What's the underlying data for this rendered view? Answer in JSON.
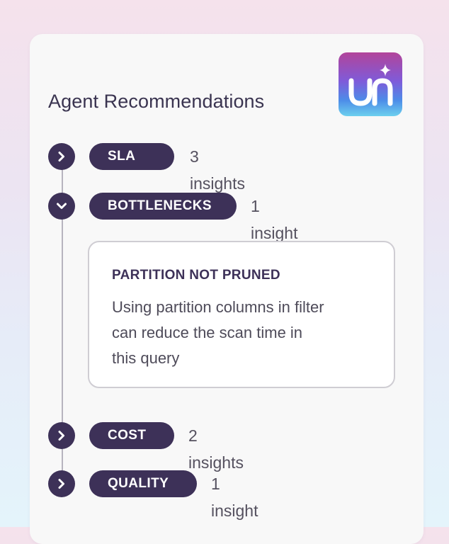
{
  "header": {
    "title": "Agent Recommendations"
  },
  "logo": {
    "icon": "un-sparkle-logo-icon"
  },
  "colors": {
    "accent": "#3d3158",
    "card_bg": "#f8f8f8",
    "border": "#cfcdd3"
  },
  "categories": [
    {
      "label": "SLA",
      "count": "3 insights",
      "expanded": false,
      "icon": "chevron-right-icon"
    },
    {
      "label": "BOTTLENECKS",
      "count": "1 insight",
      "expanded": true,
      "icon": "chevron-down-icon"
    },
    {
      "label": "COST",
      "count": "2 insights",
      "expanded": false,
      "icon": "chevron-right-icon"
    },
    {
      "label": "QUALITY",
      "count": "1 insight",
      "expanded": false,
      "icon": "chevron-right-icon"
    }
  ],
  "insight": {
    "title": "PARTITION NOT PRUNED",
    "lines": [
      "Using partition columns in filter",
      "can reduce the scan time in",
      "this query"
    ]
  }
}
